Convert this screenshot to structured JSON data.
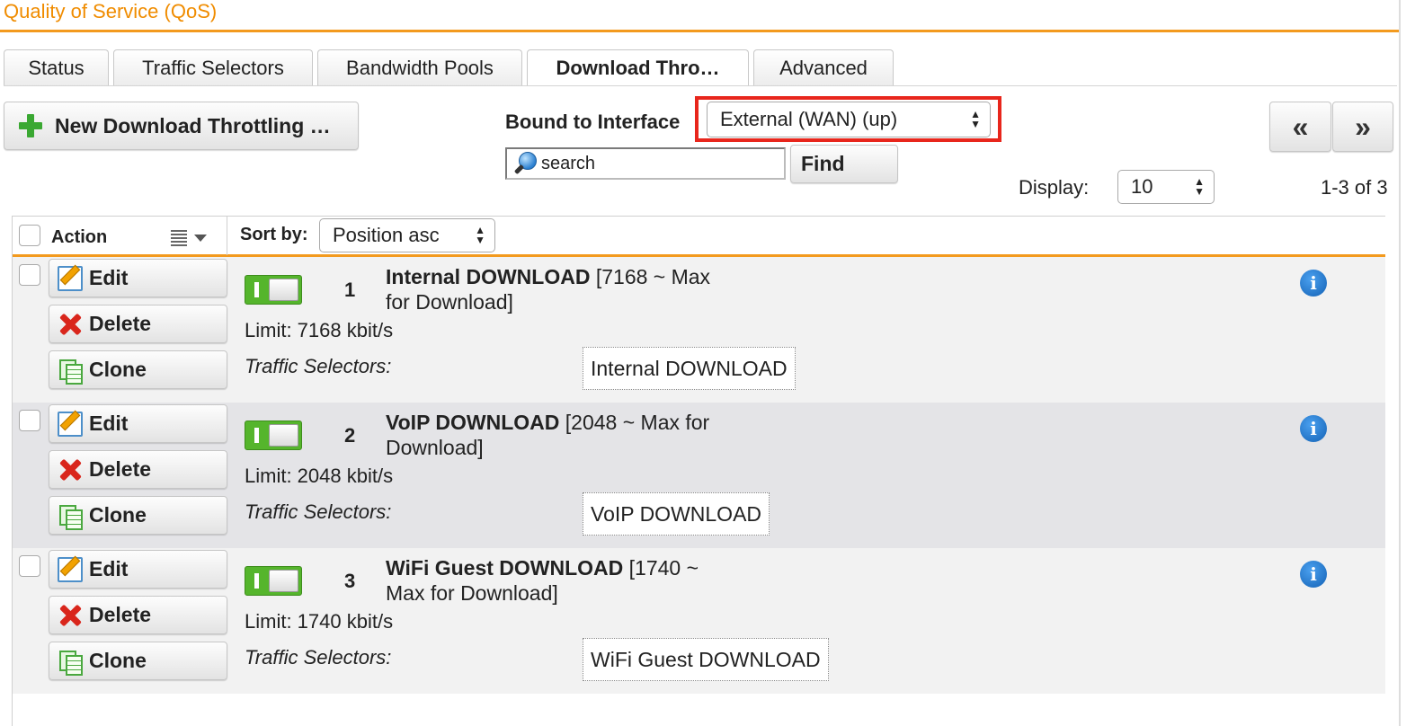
{
  "page": {
    "title": "Quality of Service (QoS)"
  },
  "tabs": [
    {
      "label": "Status",
      "active": false
    },
    {
      "label": "Traffic Selectors",
      "active": false
    },
    {
      "label": "Bandwidth Pools",
      "active": false
    },
    {
      "label": "Download Thro…",
      "active": true
    },
    {
      "label": "Advanced",
      "active": false
    }
  ],
  "toolbar": {
    "new_label": "New Download Throttling …",
    "bound_label": "Bound to Interface",
    "interface_value": "External (WAN) (up)",
    "search_placeholder": "search",
    "find_label": "Find",
    "prev_label": "«",
    "next_label": "»",
    "display_label": "Display:",
    "display_value": "10",
    "range_text": "1-3 of 3"
  },
  "table": {
    "action_header": "Action",
    "sort_label": "Sort by:",
    "sort_value": "Position asc",
    "edit_label": "Edit",
    "delete_label": "Delete",
    "clone_label": "Clone",
    "ts_label": "Traffic Selectors:",
    "rows": [
      {
        "position": "1",
        "name": "Internal DOWNLOAD",
        "detail_a": " [7168 ~ Max",
        "detail_b": "for Download]",
        "limit": "Limit: 7168 kbit/s",
        "selector": "Internal DOWNLOAD",
        "enabled": true
      },
      {
        "position": "2",
        "name": "VoIP DOWNLOAD",
        "detail_a": " [2048 ~ Max for",
        "detail_b": "Download]",
        "limit": "Limit: 2048 kbit/s",
        "selector": "VoIP DOWNLOAD",
        "enabled": true
      },
      {
        "position": "3",
        "name": "WiFi Guest DOWNLOAD",
        "detail_a": " [1740 ~",
        "detail_b": "Max for Download]",
        "limit": "Limit: 1740 kbit/s",
        "selector": "WiFi Guest DOWNLOAD",
        "enabled": true
      }
    ]
  },
  "colors": {
    "accent": "#f39a1e",
    "title": "#f08c00",
    "highlight": "#e8261c",
    "toggle_on": "#55b52c",
    "info": "#1462b5"
  },
  "icons": [
    "plus-icon",
    "search-icon",
    "edit-icon",
    "delete-icon",
    "clone-icon",
    "info-icon",
    "list-options-icon"
  ]
}
